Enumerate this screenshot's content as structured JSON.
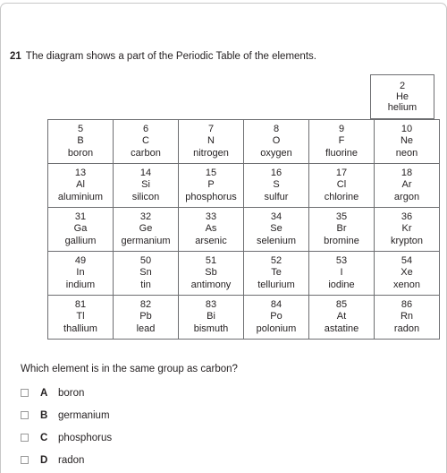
{
  "question": {
    "number": "21",
    "stem": "The diagram shows a part of the Periodic Table of the elements.",
    "prompt": "Which element is in the same group as carbon?"
  },
  "periodic_table": {
    "detached_cell": {
      "number": "2",
      "symbol": "He",
      "name": "helium"
    },
    "rows": [
      [
        {
          "number": "5",
          "symbol": "B",
          "name": "boron"
        },
        {
          "number": "6",
          "symbol": "C",
          "name": "carbon"
        },
        {
          "number": "7",
          "symbol": "N",
          "name": "nitrogen"
        },
        {
          "number": "8",
          "symbol": "O",
          "name": "oxygen"
        },
        {
          "number": "9",
          "symbol": "F",
          "name": "fluorine"
        },
        {
          "number": "10",
          "symbol": "Ne",
          "name": "neon"
        }
      ],
      [
        {
          "number": "13",
          "symbol": "Al",
          "name": "aluminium"
        },
        {
          "number": "14",
          "symbol": "Si",
          "name": "silicon"
        },
        {
          "number": "15",
          "symbol": "P",
          "name": "phosphorus"
        },
        {
          "number": "16",
          "symbol": "S",
          "name": "sulfur"
        },
        {
          "number": "17",
          "symbol": "Cl",
          "name": "chlorine"
        },
        {
          "number": "18",
          "symbol": "Ar",
          "name": "argon"
        }
      ],
      [
        {
          "number": "31",
          "symbol": "Ga",
          "name": "gallium"
        },
        {
          "number": "32",
          "symbol": "Ge",
          "name": "germanium"
        },
        {
          "number": "33",
          "symbol": "As",
          "name": "arsenic"
        },
        {
          "number": "34",
          "symbol": "Se",
          "name": "selenium"
        },
        {
          "number": "35",
          "symbol": "Br",
          "name": "bromine"
        },
        {
          "number": "36",
          "symbol": "Kr",
          "name": "krypton"
        }
      ],
      [
        {
          "number": "49",
          "symbol": "In",
          "name": "indium"
        },
        {
          "number": "50",
          "symbol": "Sn",
          "name": "tin"
        },
        {
          "number": "51",
          "symbol": "Sb",
          "name": "antimony"
        },
        {
          "number": "52",
          "symbol": "Te",
          "name": "tellurium"
        },
        {
          "number": "53",
          "symbol": "I",
          "name": "iodine"
        },
        {
          "number": "54",
          "symbol": "Xe",
          "name": "xenon"
        }
      ],
      [
        {
          "number": "81",
          "symbol": "Tl",
          "name": "thallium"
        },
        {
          "number": "82",
          "symbol": "Pb",
          "name": "lead"
        },
        {
          "number": "83",
          "symbol": "Bi",
          "name": "bismuth"
        },
        {
          "number": "84",
          "symbol": "Po",
          "name": "polonium"
        },
        {
          "number": "85",
          "symbol": "At",
          "name": "astatine"
        },
        {
          "number": "86",
          "symbol": "Rn",
          "name": "radon"
        }
      ]
    ]
  },
  "options": [
    {
      "letter": "A",
      "text": "boron"
    },
    {
      "letter": "B",
      "text": "germanium"
    },
    {
      "letter": "C",
      "text": "phosphorus"
    },
    {
      "letter": "D",
      "text": "radon"
    }
  ]
}
